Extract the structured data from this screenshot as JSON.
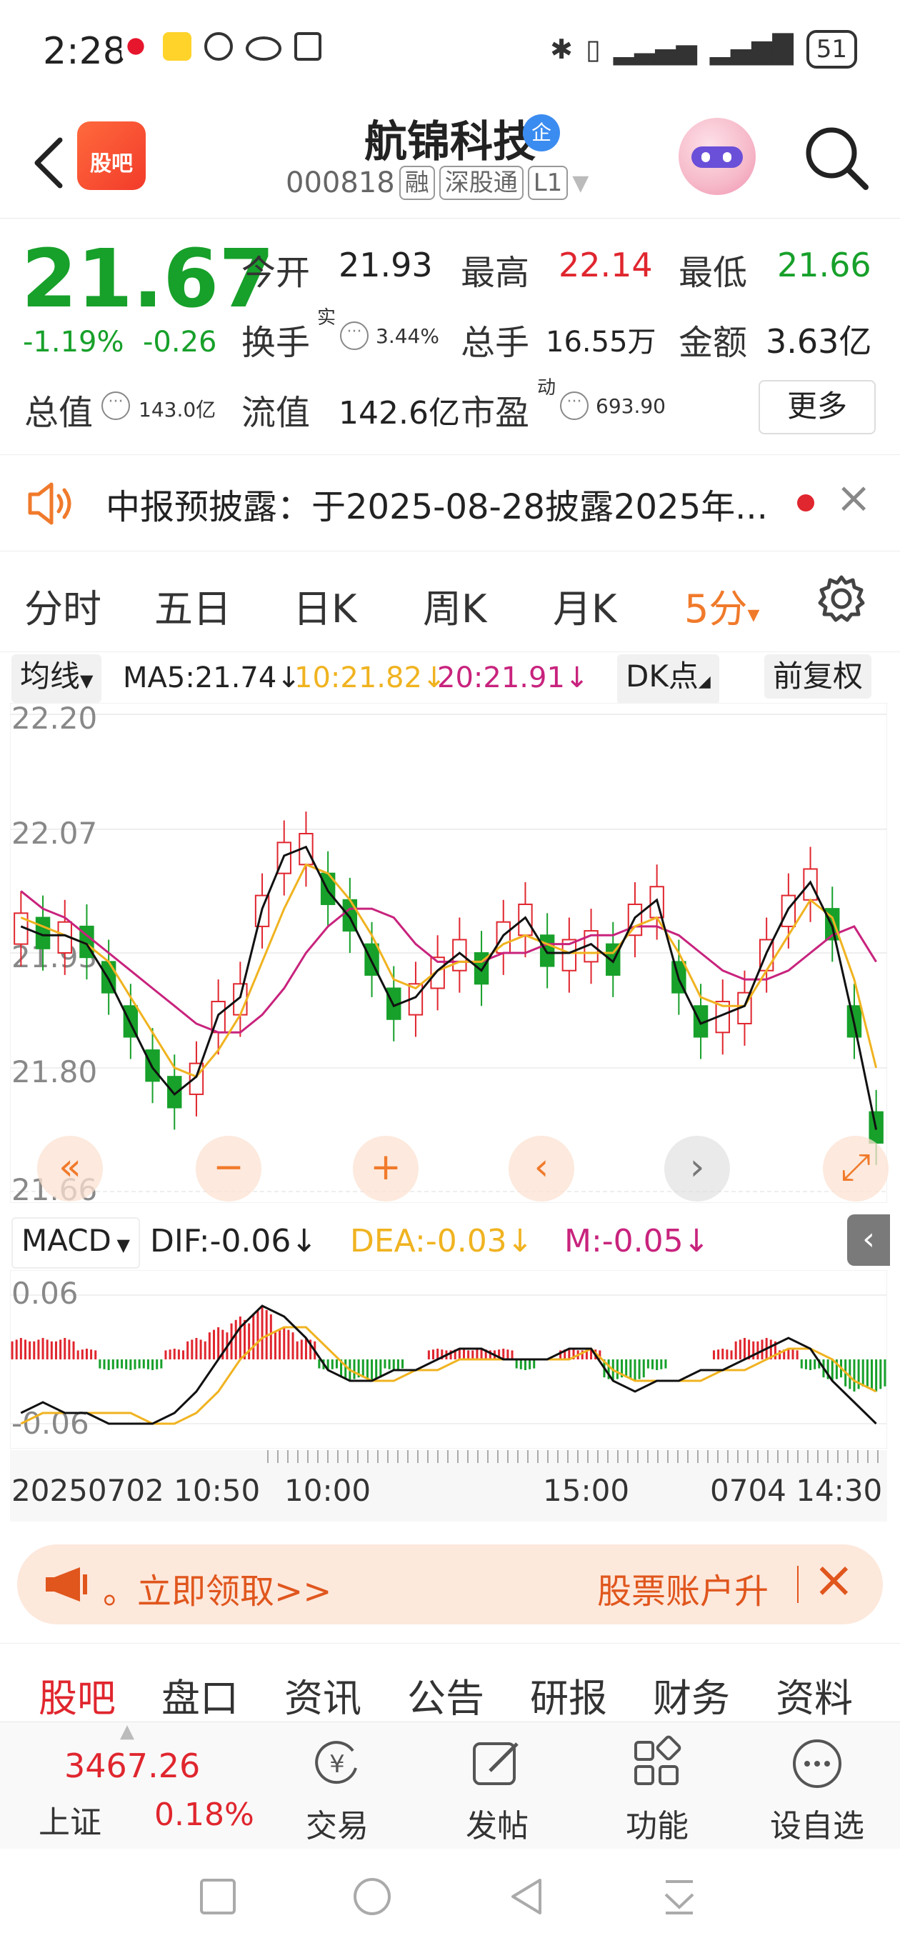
{
  "status_bar": {
    "time": "2:28",
    "battery": "51",
    "icons": [
      "weibo-icon",
      "app-icon",
      "settings-icon",
      "eye-icon",
      "nfc-icon"
    ]
  },
  "header": {
    "app_logo_text": "股吧",
    "stock_name": "航锦科技",
    "badge": "企",
    "code": "000818",
    "tags": [
      "融",
      "深股通",
      "L1"
    ]
  },
  "quote": {
    "price": "21.67",
    "change_pct": "-1.19%",
    "change_abs": "-0.26",
    "open_label": "今开",
    "open": "21.93",
    "high_label": "最高",
    "high": "22.14",
    "low_label": "最低",
    "low": "21.66",
    "turnover_label": "换手",
    "turnover_sup": "实",
    "turnover": "3.44%",
    "volume_label": "总手",
    "volume": "16.55万",
    "amount_label": "金额",
    "amount": "3.63亿",
    "mktcap_label": "总值",
    "mktcap": "143.0亿",
    "float_label": "流值",
    "float": "142.6亿",
    "pe_label": "市盈",
    "pe_sup": "动",
    "pe": "693.90",
    "more_label": "更多"
  },
  "notice": {
    "text": "中报预披露：于2025-08-28披露2025年..."
  },
  "kline_tabs": {
    "items": [
      "分时",
      "五日",
      "日K",
      "周K",
      "月K"
    ],
    "active": "5分",
    "active_caret": "▾"
  },
  "ma_bar": {
    "dropdown": "均线",
    "ma5": "MA5:21.74↓",
    "ma10": "10:21.82↓",
    "ma20": "20:21.91↓",
    "dk": "DK点",
    "adjust": "前复权"
  },
  "chart_data": {
    "type": "candlestick",
    "y_ticks": [
      "22.20",
      "22.07",
      "21.93",
      "21.80",
      "21.66"
    ],
    "ylim": [
      21.66,
      22.2
    ],
    "colors": {
      "up": "#e0262e",
      "down": "#17a02a",
      "ma5": "#111111",
      "ma10": "#f0b320",
      "ma20": "#c8237d"
    },
    "ma5_values": [
      21.96,
      21.95,
      21.95,
      21.94,
      21.9,
      21.85,
      21.8,
      21.77,
      21.79,
      21.86,
      21.88,
      21.98,
      22.04,
      22.05,
      22.0,
      21.97,
      21.92,
      21.87,
      21.88,
      21.91,
      21.93,
      21.91,
      21.95,
      21.97,
      21.93,
      21.93,
      21.94,
      21.92,
      21.97,
      21.99,
      21.9,
      21.85,
      21.86,
      21.87,
      21.93,
      21.98,
      22.01,
      21.96,
      21.85,
      21.73
    ],
    "ma10_values": [
      21.97,
      21.96,
      21.95,
      21.94,
      21.92,
      21.88,
      21.84,
      21.8,
      21.79,
      21.82,
      21.86,
      21.92,
      21.98,
      22.03,
      22.02,
      21.99,
      21.95,
      21.9,
      21.89,
      21.91,
      21.92,
      21.92,
      21.94,
      21.95,
      21.94,
      21.93,
      21.93,
      21.93,
      21.96,
      21.97,
      21.93,
      21.88,
      21.87,
      21.87,
      21.91,
      21.95,
      21.99,
      21.97,
      21.9,
      21.8
    ],
    "ma20_values": [
      22.0,
      21.98,
      21.97,
      21.95,
      21.93,
      21.91,
      21.89,
      21.87,
      21.85,
      21.84,
      21.84,
      21.86,
      21.89,
      21.93,
      21.96,
      21.98,
      21.98,
      21.97,
      21.94,
      21.92,
      21.92,
      21.92,
      21.93,
      21.93,
      21.94,
      21.94,
      21.95,
      21.95,
      21.96,
      21.96,
      21.95,
      21.93,
      21.91,
      21.9,
      21.9,
      21.91,
      21.93,
      21.95,
      21.96,
      21.92
    ]
  },
  "chart_controls": [
    "«",
    "−",
    "+",
    "‹",
    "›",
    "⤢"
  ],
  "macd_bar": {
    "dropdown": "MACD",
    "dif": "DIF:-0.06↓",
    "dea": "DEA:-0.03↓",
    "m": "M:-0.05↓"
  },
  "macd_data": {
    "y_ticks": [
      "0.06",
      "-0.06"
    ],
    "hist": [
      0.02,
      0.02,
      0.02,
      0.01,
      -0.01,
      -0.01,
      -0.01,
      0.01,
      0.02,
      0.03,
      0.04,
      0.05,
      0.03,
      0.02,
      -0.01,
      -0.02,
      -0.02,
      -0.01,
      0.0,
      0.01,
      0.01,
      0.01,
      0.01,
      -0.01,
      0.0,
      0.01,
      0.01,
      -0.02,
      -0.02,
      -0.01,
      0.0,
      0.0,
      0.01,
      0.02,
      0.02,
      0.01,
      -0.01,
      -0.02,
      -0.03,
      -0.03
    ],
    "dif": [
      -0.05,
      -0.04,
      -0.05,
      -0.05,
      -0.06,
      -0.06,
      -0.06,
      -0.05,
      -0.03,
      0.0,
      0.03,
      0.05,
      0.04,
      0.02,
      -0.01,
      -0.02,
      -0.02,
      -0.01,
      -0.01,
      0.0,
      0.01,
      0.01,
      0.0,
      0.0,
      0.0,
      0.01,
      0.01,
      -0.02,
      -0.03,
      -0.02,
      -0.02,
      -0.01,
      -0.01,
      0.0,
      0.01,
      0.02,
      0.01,
      -0.02,
      -0.04,
      -0.06
    ],
    "dea": [
      -0.06,
      -0.05,
      -0.05,
      -0.05,
      -0.05,
      -0.05,
      -0.06,
      -0.06,
      -0.05,
      -0.03,
      0.0,
      0.02,
      0.03,
      0.03,
      0.01,
      -0.01,
      -0.02,
      -0.02,
      -0.01,
      -0.01,
      0.0,
      0.0,
      0.0,
      0.0,
      0.0,
      0.0,
      0.01,
      -0.01,
      -0.02,
      -0.02,
      -0.02,
      -0.02,
      -0.01,
      -0.01,
      0.0,
      0.01,
      0.01,
      0.0,
      -0.02,
      -0.03
    ]
  },
  "time_axis": [
    "20250702 10:50",
    "10:00",
    "15:00",
    "0704 14:30"
  ],
  "banner": {
    "left_text": "。立即领取>>",
    "right_text": "股票账户升",
    "close": "×"
  },
  "bottom_tabs": {
    "items": [
      "股吧",
      "盘口",
      "资讯",
      "公告",
      "研报",
      "财务",
      "资料"
    ],
    "active_index": 0
  },
  "nav": {
    "index_value": "3467.26",
    "index_name": "上证",
    "index_change": "0.18%",
    "items": [
      "交易",
      "发帖",
      "功能",
      "设自选"
    ]
  }
}
